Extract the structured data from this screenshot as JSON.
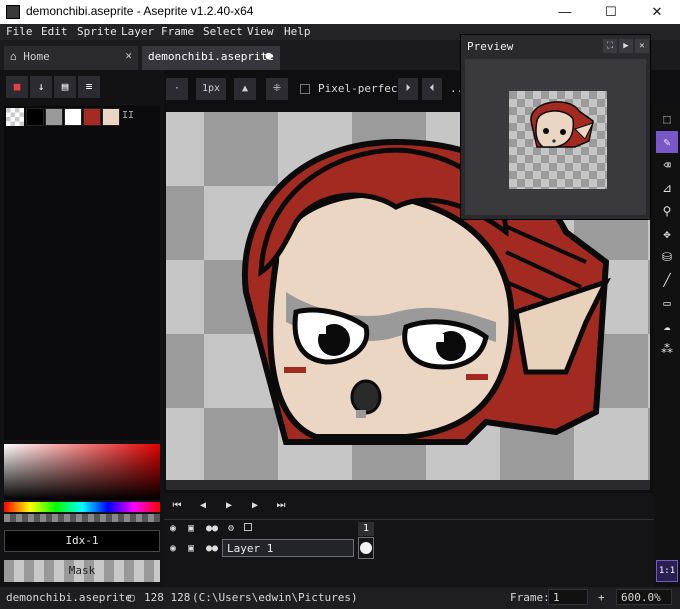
{
  "window": {
    "title": "demonchibi.aseprite - Aseprite v1.2.40-x64",
    "minimize": "—",
    "maximize": "☐",
    "close": "✕"
  },
  "menu": [
    "File",
    "Edit",
    "Sprite",
    "Layer",
    "Frame",
    "Select",
    "View",
    "Help"
  ],
  "tabs": [
    {
      "label": "Home",
      "icon": "home-icon"
    },
    {
      "label": "demonchibi.aseprite",
      "modified": true
    }
  ],
  "toolbar": {
    "brush_size": "1px",
    "pixel_perfect_label": "Pixel-perfect",
    "more": "..."
  },
  "palette": {
    "colors": [
      "#000000",
      "#9a9a9a",
      "#ffffff",
      "#a52a22",
      "#ead6c2"
    ]
  },
  "color_panel": {
    "index_label": "Idx-1",
    "mask_label": "Mask"
  },
  "preview": {
    "title": "Preview"
  },
  "timeline": {
    "frame_number": "1",
    "layer_name": "Layer 1"
  },
  "status": {
    "filename": "demonchibi.aseprite",
    "size": "128 128",
    "path": "(C:\\Users\\edwin\\Pictures)",
    "frame_label": "Frame:",
    "frame_value": "1",
    "zoom": "600.0%",
    "zoom_plus": "+"
  },
  "zoom_fit_label": "1:1"
}
